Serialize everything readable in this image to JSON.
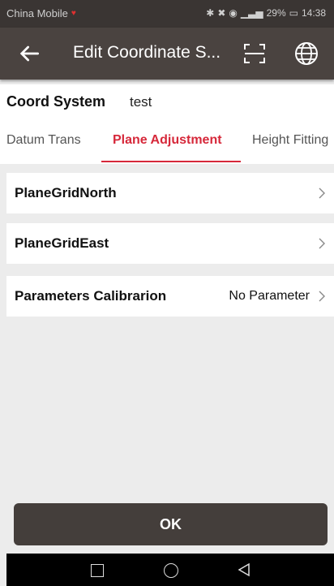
{
  "status_bar": {
    "carrier": "China Mobile",
    "battery": "29%",
    "time": "14:38"
  },
  "app_bar": {
    "title": "Edit Coordinate S...",
    "back_icon": "arrow-left-icon",
    "scan_icon": "scan-icon",
    "globe_icon": "globe-icon"
  },
  "coord_system": {
    "label": "Coord System",
    "value": "test"
  },
  "tabs": [
    {
      "label": "Datum Trans",
      "active": false
    },
    {
      "label": "Plane Adjustment",
      "active": true
    },
    {
      "label": "Height Fitting",
      "active": false
    }
  ],
  "rows": [
    {
      "label": "PlaneGridNorth",
      "value": ""
    },
    {
      "label": "PlaneGridEast",
      "value": ""
    },
    {
      "label": "Parameters Calibrarion",
      "value": "No Parameter"
    }
  ],
  "ok_button": {
    "label": "OK"
  },
  "colors": {
    "app_bar": "#4a4340",
    "status_bar": "#3a3533",
    "accent": "#d6283a",
    "button": "#443e3b"
  }
}
